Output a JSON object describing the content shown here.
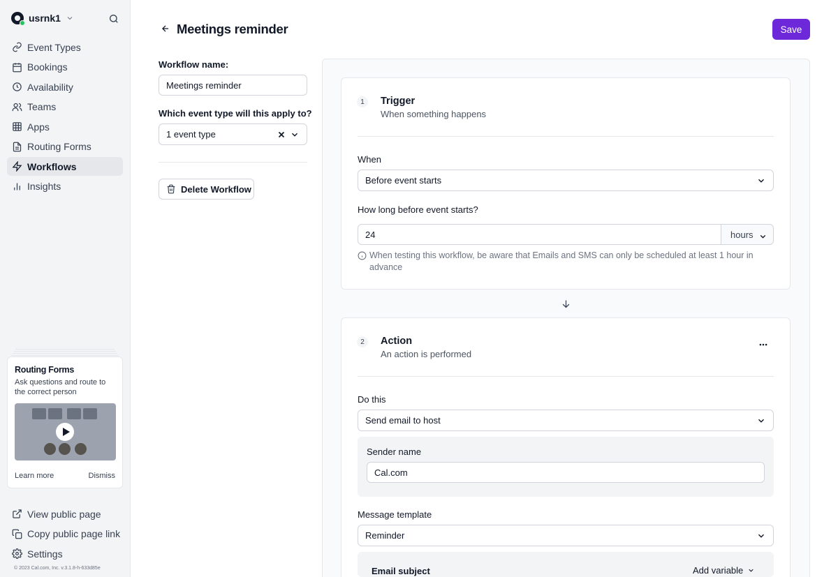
{
  "sidebar": {
    "username": "usrnk1",
    "nav": [
      {
        "label": "Event Types",
        "icon": "link-icon"
      },
      {
        "label": "Bookings",
        "icon": "calendar-icon"
      },
      {
        "label": "Availability",
        "icon": "clock-icon"
      },
      {
        "label": "Teams",
        "icon": "users-icon"
      },
      {
        "label": "Apps",
        "icon": "grid-icon"
      },
      {
        "label": "Routing Forms",
        "icon": "file-text-icon"
      },
      {
        "label": "Workflows",
        "icon": "zap-icon",
        "active": true
      },
      {
        "label": "Insights",
        "icon": "bar-chart-icon"
      }
    ],
    "promo": {
      "title": "Routing Forms",
      "text": "Ask questions and route to the correct person",
      "learn_more": "Learn more",
      "dismiss": "Dismiss"
    },
    "bottom_nav": [
      {
        "label": "View public page",
        "icon": "external-link-icon"
      },
      {
        "label": "Copy public page link",
        "icon": "copy-icon"
      },
      {
        "label": "Settings",
        "icon": "settings-icon"
      }
    ],
    "copyright": "© 2023 Cal.com, Inc. v.3.1.8-h-633d85e"
  },
  "header": {
    "title": "Meetings reminder",
    "save_label": "Save"
  },
  "form": {
    "workflow_name_label": "Workflow name:",
    "workflow_name_value": "Meetings reminder",
    "event_type_label": "Which event type will this apply to?",
    "event_type_value": "1 event type",
    "delete_label": "Delete Workflow"
  },
  "trigger": {
    "number": "1",
    "title": "Trigger",
    "subtitle": "When something happens",
    "when_label": "When",
    "when_value": "Before event starts",
    "how_long_label": "How long before event starts?",
    "how_long_value": "24",
    "unit_value": "hours",
    "note": "When testing this workflow, be aware that Emails and SMS can only be scheduled at least 1 hour in advance"
  },
  "action": {
    "number": "2",
    "title": "Action",
    "subtitle": "An action is performed",
    "do_this_label": "Do this",
    "do_this_value": "Send email to host",
    "sender_name_label": "Sender name",
    "sender_name_value": "Cal.com",
    "message_template_label": "Message template",
    "message_template_value": "Reminder",
    "email_subject_label": "Email subject",
    "add_variable_label": "Add variable"
  },
  "colors": {
    "accent": "#6d28d9",
    "sidebar_bg": "#f3f4f6",
    "active_nav_bg": "#e5e7eb"
  }
}
